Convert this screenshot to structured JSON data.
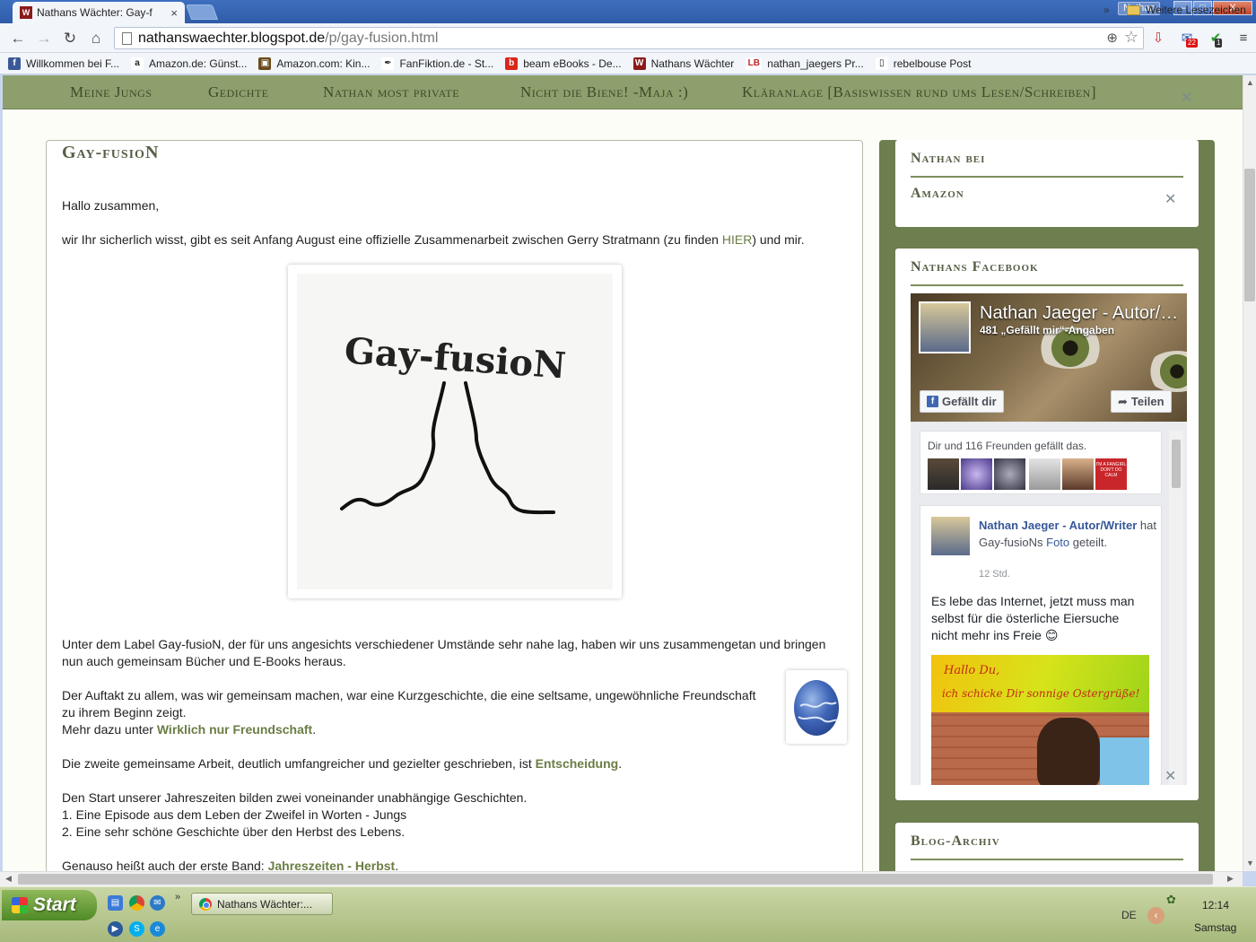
{
  "browser": {
    "tab_title": "Nathans Wächter: Gay-f",
    "tab_close": "×",
    "user_label": "Nathan",
    "win_min": "–",
    "win_max": "□",
    "win_close": "X",
    "url_host": "nathanswaechter.blogspot.de",
    "url_path": "/p/gay-fusion.html",
    "mail_badge": "22",
    "ext_badge": "1"
  },
  "bookmarks": [
    {
      "label": "Willkommen bei F...",
      "icon": "facebook-icon",
      "color": "#3b5998",
      "glyph": "f"
    },
    {
      "label": "Amazon.de: Günst...",
      "icon": "amazon-icon",
      "color": "#ffffff",
      "glyph": "a"
    },
    {
      "label": "Amazon.com: Kin...",
      "icon": "kindle-icon",
      "color": "#6b4a1a",
      "glyph": "▣"
    },
    {
      "label": "FanFiktion.de - St...",
      "icon": "quill-icon",
      "color": "#ffffff",
      "glyph": "✒"
    },
    {
      "label": "beam eBooks - De...",
      "icon": "beam-icon",
      "color": "#d9261c",
      "glyph": "b"
    },
    {
      "label": "Nathans Wächter",
      "icon": "blog-icon",
      "color": "#8b1a1a",
      "glyph": "W"
    },
    {
      "label": "nathan_jaegers Pr...",
      "icon": "lovelybooks-icon",
      "color": "#ffffff",
      "glyph": "LB"
    },
    {
      "label": "rebelbouse Post",
      "icon": "page-icon",
      "color": "#ffffff",
      "glyph": "▯"
    }
  ],
  "bookmarks_more": "»",
  "bookmarks_folder": "Weitere Lesezeichen",
  "blog_nav": [
    "Meine Jungs",
    "Gedichte",
    "Nathan most private",
    "Nicht die Biene! -Maja :)",
    "Kläranlage [Basiswissen rund ums Lesen/Schreiben]"
  ],
  "post": {
    "title": "Gay-fusioN",
    "greeting": "Hallo zusammen,",
    "intro_before": "wir Ihr sicherlich wisst, gibt es seit Anfang August eine offizielle Zusammenarbeit zwischen Gerry Stratmann (zu finden ",
    "intro_link": "HIER",
    "intro_after": ") und mir.",
    "logo_text": "Gay-fusioN",
    "label_text": "Unter dem Label Gay-fusioN, der für uns angesichts verschiedener Umstände sehr nahe lag, haben wir uns zusammengetan und bringen nun auch gemeinsam Bücher und E-Books heraus.",
    "auftakt_line1": "Der Auftakt zu allem, was wir gemeinsam machen, war eine Kurzgeschichte, die eine seltsame, ungewöhnliche Freundschaft",
    "auftakt_line2": "zu ihrem Beginn zeigt.",
    "mehr_before": "Mehr dazu unter ",
    "mehr_link": "Wirklich nur Freundschaft",
    "mehr_after": ".",
    "zweite_before": "Die zweite gemeinsame Arbeit, deutlich umfangreicher und gezielter geschrieben, ist ",
    "zweite_link": "Entscheidung",
    "zweite_after": ".",
    "start_line": "Den Start unserer Jahreszeiten bilden zwei voneinander unabhängige Geschichten.",
    "list_1": "1. Eine Episode aus dem Leben der Zweifel in Worten - Jungs",
    "list_2": "2. Eine sehr schöne Geschichte über den Herbst des Lebens.",
    "band_before": "Genauso heißt auch der erste Band: ",
    "band_link": "Jahreszeiten - Herbst",
    "band_after": "."
  },
  "sidebar": {
    "amazon_title_1": "Nathan bei",
    "amazon_title_2": "Amazon",
    "facebook_title": "Nathans Facebook",
    "archive_title": "Blog-Archiv"
  },
  "facebook": {
    "page_name": "Nathan Jaeger - Autor/Writer",
    "likes": "481 „Gefällt mir“-Angaben",
    "like_button": "Gefällt dir",
    "share_button": "Teilen",
    "friends_text": "Dir und 116 Freunden gefällt das.",
    "post_author": "Nathan Jaeger - Autor/Writer",
    "post_action": " hat Gay-fusioNs ",
    "post_object": "Foto",
    "post_suffix": " geteilt.",
    "post_time": "12 Std.",
    "post_text": "Es lebe das Internet, jetzt muss man selbst für die österliche Eiersuche nicht mehr ins Freie 😊",
    "image_line1": "Hallo Du,",
    "image_line2": "ich schicke Dir sonnige Ostergrüße!",
    "fanpage_badge": "I'M A FANGIRL DON'T DO CALM"
  },
  "taskbar": {
    "start_label": "Start",
    "quick_more": "»",
    "task_label": "Nathans Wächter:...",
    "lang": "DE",
    "time": "12:14",
    "day": "Samstag"
  },
  "colors": {
    "nav_bg": "#8d9f6c",
    "sidebar_bg": "#6d7e4f",
    "link": "#6b7d44",
    "heading": "#555f45"
  }
}
